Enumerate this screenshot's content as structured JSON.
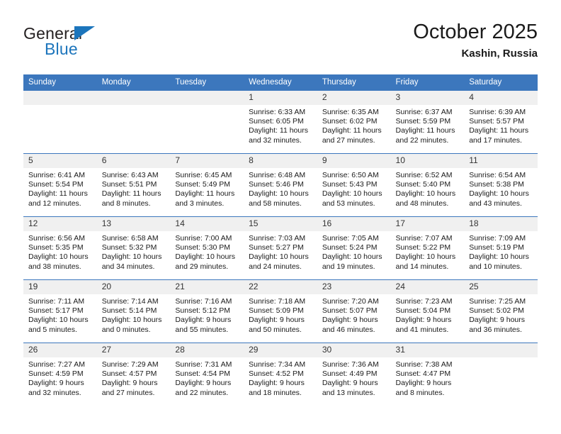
{
  "brand": {
    "name_top": "General",
    "name_bottom": "Blue"
  },
  "header": {
    "title": "October 2025",
    "location": "Kashin, Russia"
  },
  "columns": [
    "Sunday",
    "Monday",
    "Tuesday",
    "Wednesday",
    "Thursday",
    "Friday",
    "Saturday"
  ],
  "colors": {
    "header_blue": "#3c77bd",
    "brand_blue": "#1c75bc",
    "daynum_band": "#f0f0f0",
    "text": "#1a1a1a"
  },
  "weeks": [
    [
      {
        "empty": true
      },
      {
        "empty": true
      },
      {
        "empty": true
      },
      {
        "day": "1",
        "sunrise": "Sunrise: 6:33 AM",
        "sunset": "Sunset: 6:05 PM",
        "daylight_1": "Daylight: 11 hours",
        "daylight_2": "and 32 minutes."
      },
      {
        "day": "2",
        "sunrise": "Sunrise: 6:35 AM",
        "sunset": "Sunset: 6:02 PM",
        "daylight_1": "Daylight: 11 hours",
        "daylight_2": "and 27 minutes."
      },
      {
        "day": "3",
        "sunrise": "Sunrise: 6:37 AM",
        "sunset": "Sunset: 5:59 PM",
        "daylight_1": "Daylight: 11 hours",
        "daylight_2": "and 22 minutes."
      },
      {
        "day": "4",
        "sunrise": "Sunrise: 6:39 AM",
        "sunset": "Sunset: 5:57 PM",
        "daylight_1": "Daylight: 11 hours",
        "daylight_2": "and 17 minutes."
      }
    ],
    [
      {
        "day": "5",
        "sunrise": "Sunrise: 6:41 AM",
        "sunset": "Sunset: 5:54 PM",
        "daylight_1": "Daylight: 11 hours",
        "daylight_2": "and 12 minutes."
      },
      {
        "day": "6",
        "sunrise": "Sunrise: 6:43 AM",
        "sunset": "Sunset: 5:51 PM",
        "daylight_1": "Daylight: 11 hours",
        "daylight_2": "and 8 minutes."
      },
      {
        "day": "7",
        "sunrise": "Sunrise: 6:45 AM",
        "sunset": "Sunset: 5:49 PM",
        "daylight_1": "Daylight: 11 hours",
        "daylight_2": "and 3 minutes."
      },
      {
        "day": "8",
        "sunrise": "Sunrise: 6:48 AM",
        "sunset": "Sunset: 5:46 PM",
        "daylight_1": "Daylight: 10 hours",
        "daylight_2": "and 58 minutes."
      },
      {
        "day": "9",
        "sunrise": "Sunrise: 6:50 AM",
        "sunset": "Sunset: 5:43 PM",
        "daylight_1": "Daylight: 10 hours",
        "daylight_2": "and 53 minutes."
      },
      {
        "day": "10",
        "sunrise": "Sunrise: 6:52 AM",
        "sunset": "Sunset: 5:40 PM",
        "daylight_1": "Daylight: 10 hours",
        "daylight_2": "and 48 minutes."
      },
      {
        "day": "11",
        "sunrise": "Sunrise: 6:54 AM",
        "sunset": "Sunset: 5:38 PM",
        "daylight_1": "Daylight: 10 hours",
        "daylight_2": "and 43 minutes."
      }
    ],
    [
      {
        "day": "12",
        "sunrise": "Sunrise: 6:56 AM",
        "sunset": "Sunset: 5:35 PM",
        "daylight_1": "Daylight: 10 hours",
        "daylight_2": "and 38 minutes."
      },
      {
        "day": "13",
        "sunrise": "Sunrise: 6:58 AM",
        "sunset": "Sunset: 5:32 PM",
        "daylight_1": "Daylight: 10 hours",
        "daylight_2": "and 34 minutes."
      },
      {
        "day": "14",
        "sunrise": "Sunrise: 7:00 AM",
        "sunset": "Sunset: 5:30 PM",
        "daylight_1": "Daylight: 10 hours",
        "daylight_2": "and 29 minutes."
      },
      {
        "day": "15",
        "sunrise": "Sunrise: 7:03 AM",
        "sunset": "Sunset: 5:27 PM",
        "daylight_1": "Daylight: 10 hours",
        "daylight_2": "and 24 minutes."
      },
      {
        "day": "16",
        "sunrise": "Sunrise: 7:05 AM",
        "sunset": "Sunset: 5:24 PM",
        "daylight_1": "Daylight: 10 hours",
        "daylight_2": "and 19 minutes."
      },
      {
        "day": "17",
        "sunrise": "Sunrise: 7:07 AM",
        "sunset": "Sunset: 5:22 PM",
        "daylight_1": "Daylight: 10 hours",
        "daylight_2": "and 14 minutes."
      },
      {
        "day": "18",
        "sunrise": "Sunrise: 7:09 AM",
        "sunset": "Sunset: 5:19 PM",
        "daylight_1": "Daylight: 10 hours",
        "daylight_2": "and 10 minutes."
      }
    ],
    [
      {
        "day": "19",
        "sunrise": "Sunrise: 7:11 AM",
        "sunset": "Sunset: 5:17 PM",
        "daylight_1": "Daylight: 10 hours",
        "daylight_2": "and 5 minutes."
      },
      {
        "day": "20",
        "sunrise": "Sunrise: 7:14 AM",
        "sunset": "Sunset: 5:14 PM",
        "daylight_1": "Daylight: 10 hours",
        "daylight_2": "and 0 minutes."
      },
      {
        "day": "21",
        "sunrise": "Sunrise: 7:16 AM",
        "sunset": "Sunset: 5:12 PM",
        "daylight_1": "Daylight: 9 hours",
        "daylight_2": "and 55 minutes."
      },
      {
        "day": "22",
        "sunrise": "Sunrise: 7:18 AM",
        "sunset": "Sunset: 5:09 PM",
        "daylight_1": "Daylight: 9 hours",
        "daylight_2": "and 50 minutes."
      },
      {
        "day": "23",
        "sunrise": "Sunrise: 7:20 AM",
        "sunset": "Sunset: 5:07 PM",
        "daylight_1": "Daylight: 9 hours",
        "daylight_2": "and 46 minutes."
      },
      {
        "day": "24",
        "sunrise": "Sunrise: 7:23 AM",
        "sunset": "Sunset: 5:04 PM",
        "daylight_1": "Daylight: 9 hours",
        "daylight_2": "and 41 minutes."
      },
      {
        "day": "25",
        "sunrise": "Sunrise: 7:25 AM",
        "sunset": "Sunset: 5:02 PM",
        "daylight_1": "Daylight: 9 hours",
        "daylight_2": "and 36 minutes."
      }
    ],
    [
      {
        "day": "26",
        "sunrise": "Sunrise: 7:27 AM",
        "sunset": "Sunset: 4:59 PM",
        "daylight_1": "Daylight: 9 hours",
        "daylight_2": "and 32 minutes."
      },
      {
        "day": "27",
        "sunrise": "Sunrise: 7:29 AM",
        "sunset": "Sunset: 4:57 PM",
        "daylight_1": "Daylight: 9 hours",
        "daylight_2": "and 27 minutes."
      },
      {
        "day": "28",
        "sunrise": "Sunrise: 7:31 AM",
        "sunset": "Sunset: 4:54 PM",
        "daylight_1": "Daylight: 9 hours",
        "daylight_2": "and 22 minutes."
      },
      {
        "day": "29",
        "sunrise": "Sunrise: 7:34 AM",
        "sunset": "Sunset: 4:52 PM",
        "daylight_1": "Daylight: 9 hours",
        "daylight_2": "and 18 minutes."
      },
      {
        "day": "30",
        "sunrise": "Sunrise: 7:36 AM",
        "sunset": "Sunset: 4:49 PM",
        "daylight_1": "Daylight: 9 hours",
        "daylight_2": "and 13 minutes."
      },
      {
        "day": "31",
        "sunrise": "Sunrise: 7:38 AM",
        "sunset": "Sunset: 4:47 PM",
        "daylight_1": "Daylight: 9 hours",
        "daylight_2": "and 8 minutes."
      },
      {
        "empty": true
      }
    ]
  ]
}
